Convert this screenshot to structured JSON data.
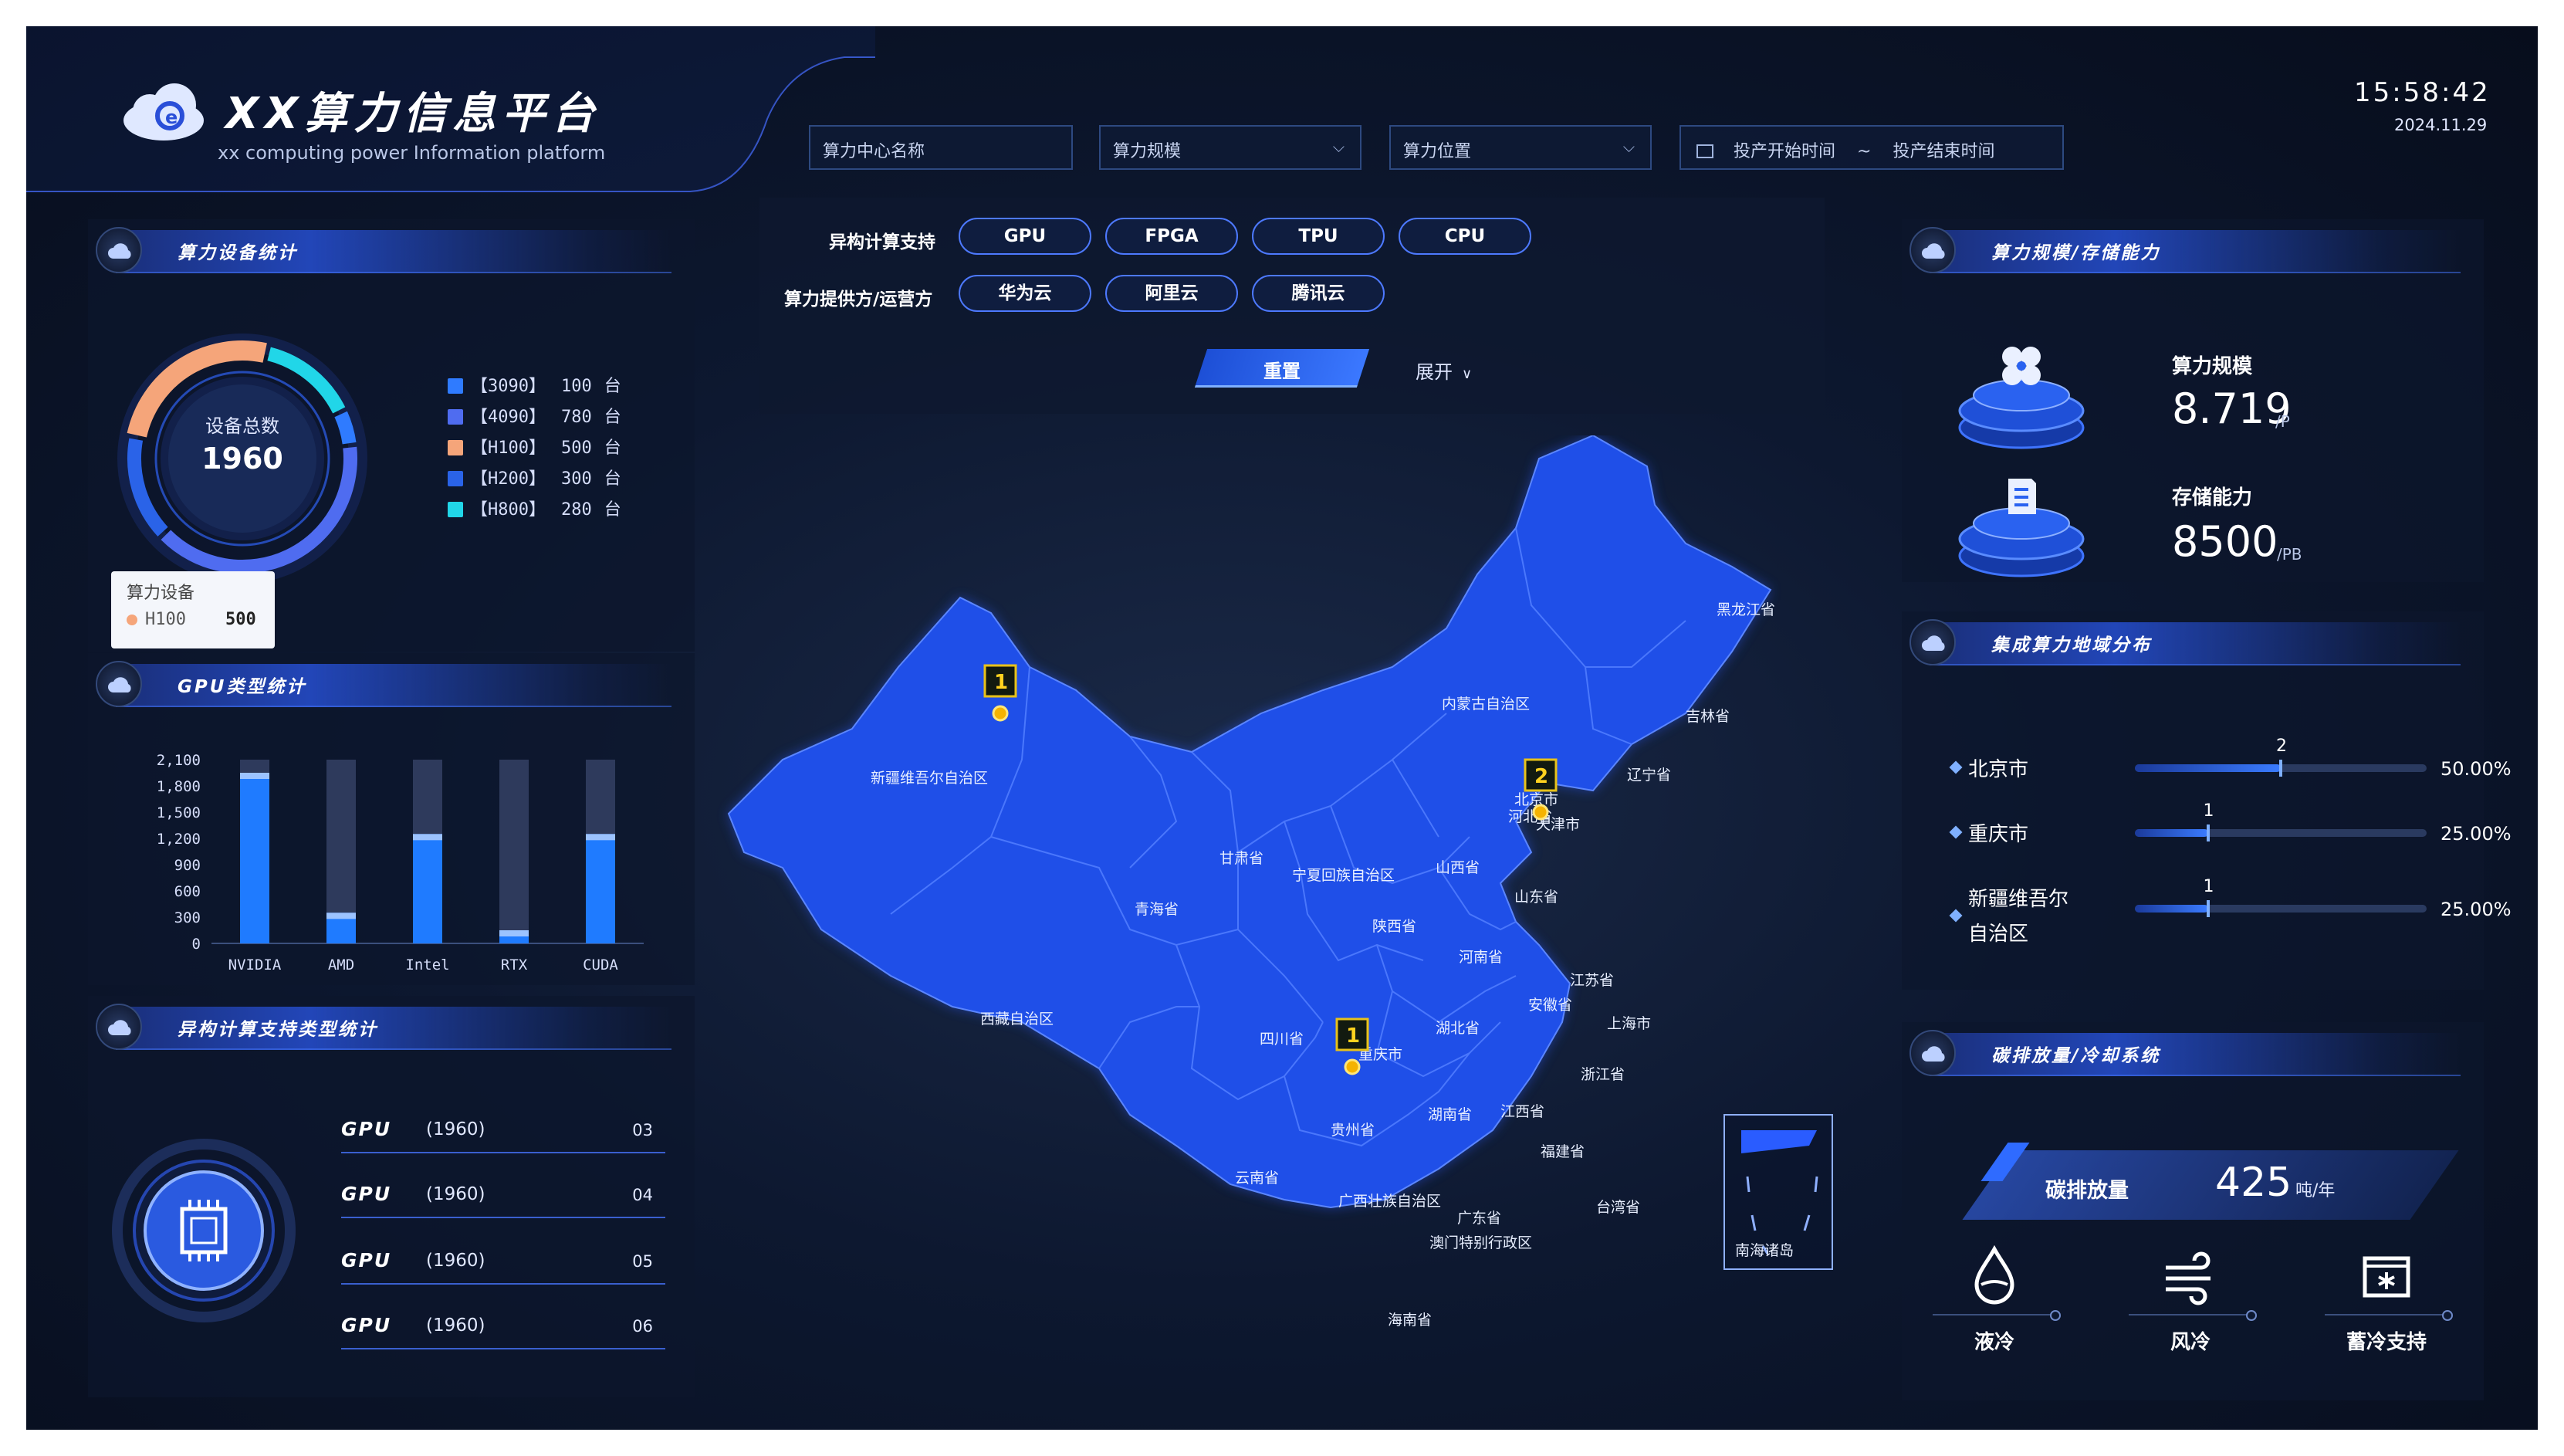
{
  "header": {
    "title": "XX算力信息平台",
    "subtitle": "xx computing power Information platform",
    "time": "15:58:42",
    "date": "2024.11.29"
  },
  "filters": {
    "center_name": "算力中心名称",
    "scale": "算力规模",
    "location": "算力位置",
    "start_time": "投产开始时间",
    "separator": "~",
    "end_time": "投产结束时间"
  },
  "selector": {
    "hetero_label": "异构计算支持",
    "hetero_options": [
      "GPU",
      "FPGA",
      "TPU",
      "CPU"
    ],
    "provider_label": "算力提供方/运营方",
    "provider_options": [
      "华为云",
      "阿里云",
      "腾讯云"
    ],
    "reset": "重置",
    "expand": "展开"
  },
  "device_stats": {
    "title": "算力设备统计",
    "center_label": "设备总数",
    "total": "1960",
    "legend": [
      {
        "name": "【3090】",
        "count": "100",
        "unit": "台",
        "color": "#2f7bff"
      },
      {
        "name": "【4090】",
        "count": "780",
        "unit": "台",
        "color": "#4f6cf0"
      },
      {
        "name": "【H100】",
        "count": "500",
        "unit": "台",
        "color": "#f5a57a"
      },
      {
        "name": "【H200】",
        "count": "300",
        "unit": "台",
        "color": "#2a63e8"
      },
      {
        "name": "【H800】",
        "count": "280",
        "unit": "台",
        "color": "#21d6e8"
      }
    ],
    "tooltip": {
      "title": "算力设备",
      "item": "H100",
      "value": "500"
    }
  },
  "gpu_stats": {
    "title": "GPU类型统计"
  },
  "chart_data": {
    "type": "bar",
    "categories": [
      "NVIDIA",
      "AMD",
      "Intel",
      "RTX",
      "CUDA"
    ],
    "values": [
      1950,
      350,
      1250,
      150,
      1250
    ],
    "max": 2100,
    "yticks": [
      "2,100",
      "1,800",
      "1,500",
      "1,200",
      "900",
      "600",
      "300",
      "0"
    ],
    "ylim": [
      0,
      2100
    ]
  },
  "hetero_stats": {
    "title": "异构计算支持类型统计",
    "rows": [
      {
        "name": "GPU",
        "count": "(1960)",
        "num": "03"
      },
      {
        "name": "GPU",
        "count": "(1960)",
        "num": "04"
      },
      {
        "name": "GPU",
        "count": "(1960)",
        "num": "05"
      },
      {
        "name": "GPU",
        "count": "(1960)",
        "num": "06"
      }
    ]
  },
  "scale_storage": {
    "title": "算力规模/存储能力",
    "scale_label": "算力规模",
    "scale_value": "8.719",
    "scale_unit": "/P",
    "storage_label": "存储能力",
    "storage_value": "8500",
    "storage_unit": "/PB"
  },
  "region_dist": {
    "title": "集成算力地域分布",
    "rows": [
      {
        "city": "北京市",
        "count": "2",
        "pct": "50.00%",
        "fraction": 0.5
      },
      {
        "city": "重庆市",
        "count": "1",
        "pct": "25.00%",
        "fraction": 0.25
      },
      {
        "city": "新疆维吾尔",
        "city2": "自治区",
        "count": "1",
        "pct": "25.00%",
        "fraction": 0.25
      }
    ]
  },
  "carbon": {
    "title": "碳排放量/冷却系统",
    "label": "碳排放量",
    "value": "425",
    "unit": "吨/年",
    "cooling": [
      "液冷",
      "风冷",
      "蓄冷支持"
    ]
  },
  "map": {
    "markers": [
      "1",
      "2",
      "1"
    ],
    "provinces": [
      "黑龙江省",
      "吉林省",
      "辽宁省",
      "内蒙古自治区",
      "北京市",
      "河北省",
      "天津市",
      "新疆维吾尔自治区",
      "甘肃省",
      "宁夏回族自治区",
      "山西省",
      "山东省",
      "青海省",
      "陕西省",
      "河南省",
      "江苏省",
      "安徽省",
      "上海市",
      "西藏自治区",
      "四川省",
      "重庆市",
      "湖北省",
      "浙江省",
      "湖南省",
      "江西省",
      "贵州省",
      "福建省",
      "云南省",
      "广西壮族自治区",
      "广东省",
      "台湾省",
      "海南省",
      "澳门特别行政区"
    ],
    "inset_label": "南海诸岛"
  }
}
